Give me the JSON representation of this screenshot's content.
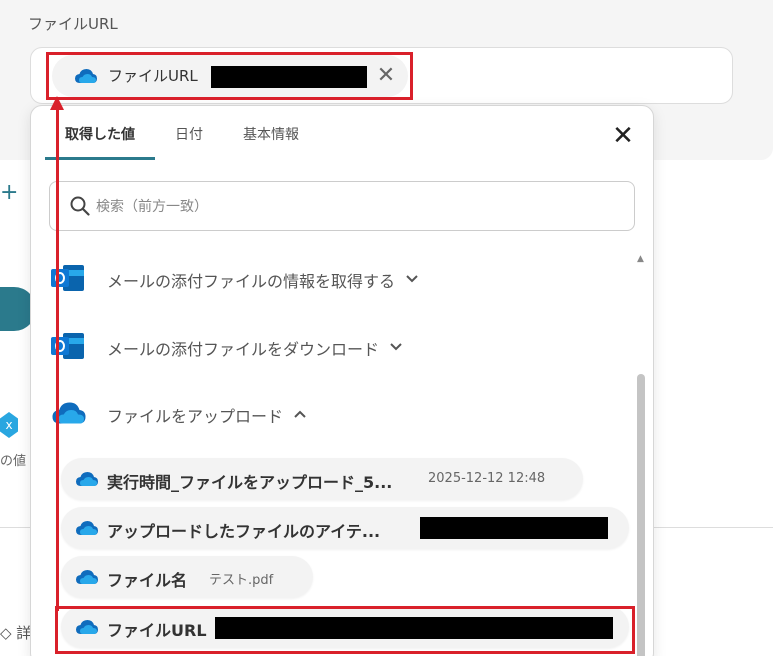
{
  "field": {
    "label": "ファイルURL",
    "chip_label": "ファイルURL"
  },
  "background": {
    "plus": "+",
    "badge": "x",
    "small_text": "の値",
    "detail_text": "◇ 詳"
  },
  "popover": {
    "tabs": [
      {
        "label": "取得した値",
        "active": true
      },
      {
        "label": "日付",
        "active": false
      },
      {
        "label": "基本情報",
        "active": false
      }
    ],
    "close": "✕",
    "search_placeholder": "検索（前方一致）",
    "groups": [
      {
        "label": "メールの添付ファイルの情報を取得する",
        "chevron": "⌄",
        "icon": "outlook-icon"
      },
      {
        "label": "メールの添付ファイルをダウンロード",
        "chevron": "⌄",
        "icon": "outlook-icon"
      },
      {
        "label": "ファイルをアップロード",
        "chevron": "⌃",
        "icon": "onedrive-cloud-icon"
      }
    ],
    "items": [
      {
        "name": "実行時間_ファイルをアップロード_5...",
        "value": "2025-12-12 12:48"
      },
      {
        "name": "アップロードしたファイルのアイテ...",
        "value": ""
      },
      {
        "name": "ファイル名",
        "value": "テスト.pdf"
      },
      {
        "name": "ファイルURL",
        "value": ""
      }
    ]
  },
  "colors": {
    "accent": "#2b7a8c",
    "annotation": "#d9202a",
    "cloud": "#0f6cbd"
  }
}
